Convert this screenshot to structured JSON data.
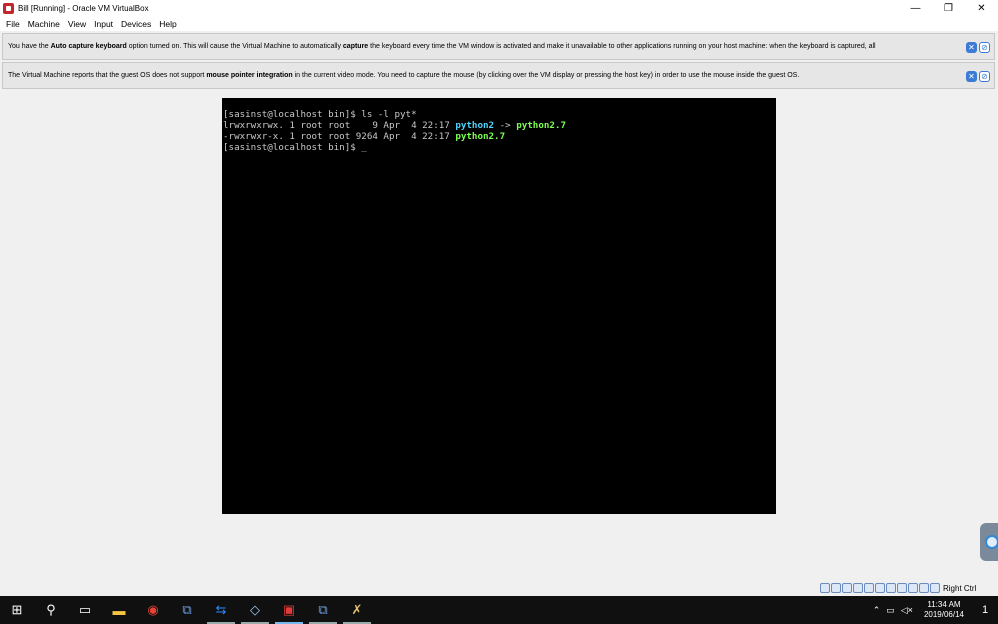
{
  "window": {
    "title": "Bill [Running] - Oracle VM VirtualBox",
    "minimize": "—",
    "restore": "❐",
    "close": "✕"
  },
  "menu": [
    "File",
    "Machine",
    "View",
    "Input",
    "Devices",
    "Help"
  ],
  "notices": [
    {
      "pre": "You have the ",
      "bold1": "Auto capture keyboard",
      "mid": " option turned on. This will cause the Virtual Machine to automatically ",
      "bold2": "capture",
      "post": " the keyboard every time the VM window is activated and make it unavailable to other applications running on your host machine: when the keyboard is captured, all"
    },
    {
      "pre": "The Virtual Machine reports that the guest OS does not support ",
      "bold1": "mouse pointer integration",
      "mid": " in the current video mode. You need to capture the mouse (by clicking over the VM display or pressing the host key) in order to use the mouse inside the guest OS.",
      "bold2": "",
      "post": ""
    }
  ],
  "terminal": {
    "line1": "[sasinst@localhost bin]$ ls -l pyt*",
    "line2_prefix": "lrwxrwxrwx. 1 root root    9 Apr  4 22:17 ",
    "line2_link": "python2",
    "line2_arrow": " -> ",
    "line2_target": "python2.7",
    "line3_prefix": "-rwxrwxr-x. 1 root root 9264 Apr  4 22:17 ",
    "line3_file": "python2.7",
    "line4": "[sasinst@localhost bin]$ _"
  },
  "statusbar": {
    "host_key": "Right Ctrl"
  },
  "taskbar": {
    "icons": [
      "windows-start-icon",
      "search-icon",
      "task-view-icon",
      "file-explorer-icon",
      "chrome-icon",
      "network-app-icon",
      "teamviewer-icon",
      "cube-app-icon",
      "virtualbox-icon",
      "network-app-icon-2",
      "tool-app-icon"
    ],
    "time": "11:34 AM",
    "date": "2019/06/14",
    "notifications": "1"
  }
}
